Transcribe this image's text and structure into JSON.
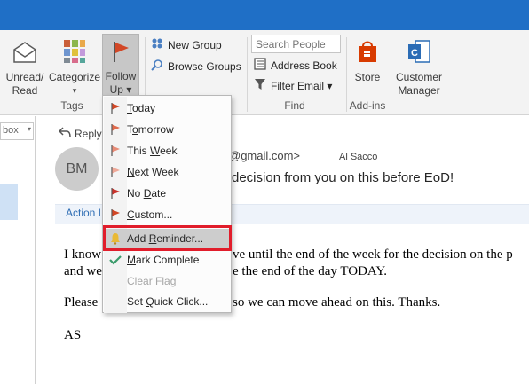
{
  "ribbon": {
    "unread_read": {
      "line1": "Unread/",
      "line2": "Read"
    },
    "categorize": {
      "line1": "Categorize",
      "line2": "▾"
    },
    "follow_up": {
      "line1": "Follow",
      "line2": "Up ▾"
    },
    "tags_group": "Tags",
    "new_group": "New Group",
    "browse_groups": "Browse Groups",
    "search_people_placeholder": "Search People",
    "address_book": "Address Book",
    "filter_email": "Filter Email ▾",
    "find_group": "Find",
    "store": "Store",
    "addins_group": "Add-ins",
    "customer_manager": {
      "line1": "Customer",
      "line2": "Manager"
    }
  },
  "folder_pane": {
    "combo_text": "box"
  },
  "message": {
    "reply_label": "Reply",
    "avatar_initials": "BM",
    "from_email_partial": "@gmail.com>",
    "to_name": "Al Sacco",
    "subject_partial": "decision from you on this before EoD!",
    "action_label": "Action I",
    "body_line1_left": "I know",
    "body_line1_right": "ve until the end of the week for the decision on the p",
    "body_line2_left": "and we",
    "body_line2_right": "e the end of the day TODAY.",
    "body_line3_left": "Please",
    "body_line3_right": "so we can move ahead on this. Thanks.",
    "body_line4": "AS"
  },
  "followup_menu": {
    "items": [
      {
        "pre": "",
        "ul": "T",
        "post": "oday",
        "icon": "flag-red-icon"
      },
      {
        "pre": "T",
        "ul": "o",
        "post": "morrow",
        "icon": "flag-red-icon"
      },
      {
        "pre": "This ",
        "ul": "W",
        "post": "eek",
        "icon": "flag-light-icon"
      },
      {
        "pre": "",
        "ul": "N",
        "post": "ext Week",
        "icon": "flag-light-icon"
      },
      {
        "pre": "No ",
        "ul": "D",
        "post": "ate",
        "icon": "flag-red-icon"
      },
      {
        "pre": "",
        "ul": "C",
        "post": "ustom...",
        "icon": "flag-red-icon"
      },
      {
        "pre": "Add ",
        "ul": "R",
        "post": "eminder...",
        "icon": "bell-icon"
      },
      {
        "pre": "",
        "ul": "M",
        "post": "ark Complete",
        "icon": "checkmark-icon"
      },
      {
        "pre": "C",
        "ul": "l",
        "post": "ear Flag",
        "icon": ""
      },
      {
        "pre": "Set ",
        "ul": "Q",
        "post": "uick Click...",
        "icon": ""
      }
    ]
  },
  "colors": {
    "title_bar": "#1f6fc6",
    "flag_red": "#d24726",
    "flag_light": "#e88b76",
    "check_green": "#3a9b6b",
    "highlight_box": "#e11d2b",
    "link_blue": "#2e6db4"
  }
}
